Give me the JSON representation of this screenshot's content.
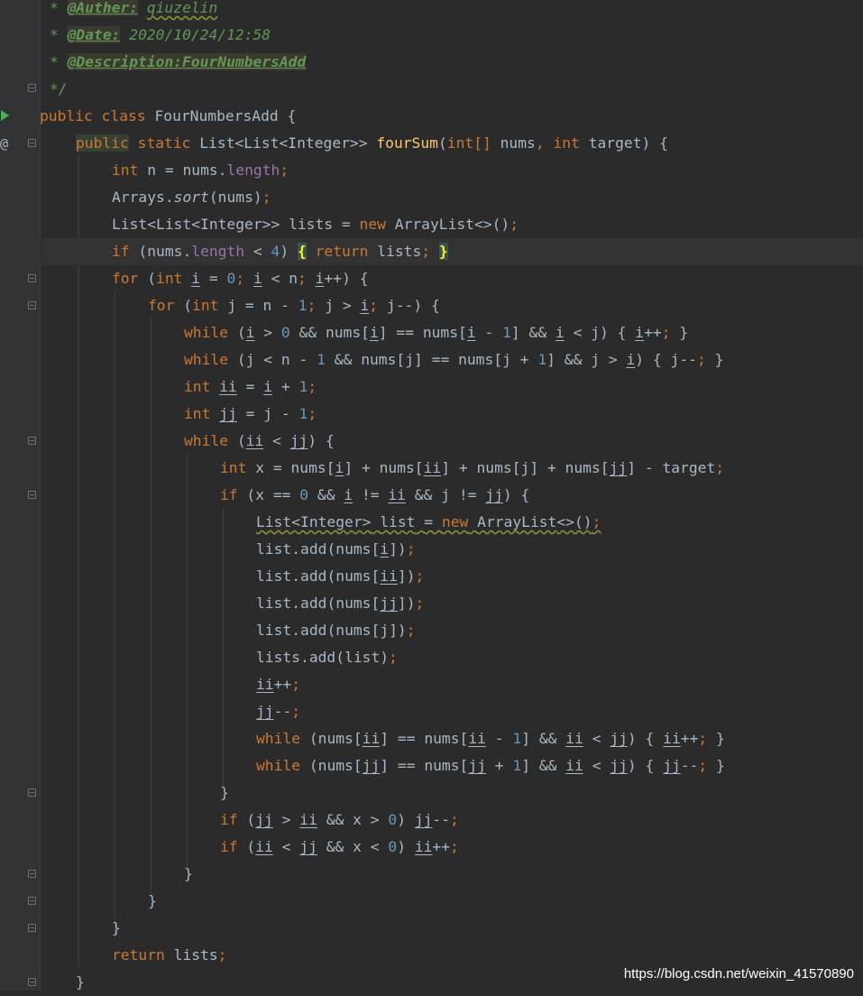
{
  "editor": {
    "language": "Java",
    "doc_comment": {
      "star": "*",
      "author_tag": "@Auther:",
      "author_value": "qiuzelin",
      "date_tag": "@Date:",
      "date_value": "2020/10/24/12:58",
      "description_tag": "@Description:FourNumbersAdd",
      "close": "*/"
    },
    "kw": {
      "public": "public",
      "class": "class",
      "static": "static",
      "int": "int",
      "new": "new",
      "if": "if",
      "return": "return",
      "for": "for",
      "while": "while"
    },
    "sym": {
      "lbrace": "{",
      "rbrace": "}",
      "lparen": "(",
      "rparen": ")",
      "semi": ";",
      "lbrack": "[",
      "rbrack": "]",
      "comma": ",",
      "dot": ".",
      "eq": "=",
      "eqeq": "==",
      "neq": "!=",
      "lt": "<",
      "gt": ">",
      "andand": "&&",
      "plus": "+",
      "minus": "-",
      "pp": "++",
      "mm": "--",
      "diamond": "<>()",
      "intarr": "int[]"
    },
    "num": {
      "zero": "0",
      "one": "1",
      "four": "4"
    },
    "ident": {
      "class_name": "FourNumbersAdd",
      "method_name": "fourSum",
      "ret_type": "List<List<Integer>>",
      "nums": "nums",
      "target": "target",
      "n": "n",
      "length": "length",
      "arrays": "Arrays",
      "sort": "sort",
      "lists": "lists",
      "arraylist": "ArrayList",
      "i": "i",
      "j": "j",
      "ii": "ii",
      "jj": "jj",
      "x": "x",
      "list_type": "List<Integer>",
      "list": "list",
      "add": "add"
    }
  },
  "watermark": "https://blog.csdn.net/weixin_41570890"
}
